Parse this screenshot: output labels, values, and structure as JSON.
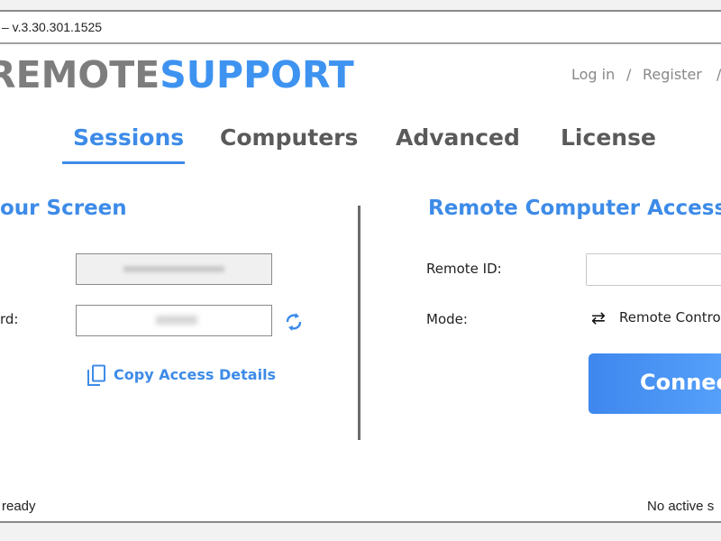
{
  "window": {
    "title": "– v.3.30.301.1525"
  },
  "logo": {
    "part1": "REMOTE",
    "part2": "SUPPORT"
  },
  "nav": {
    "login": "Log in",
    "sep1": "/",
    "register": "Register",
    "sep2": "/"
  },
  "tabs": [
    {
      "label": "Sessions",
      "active": true
    },
    {
      "label": "Computers"
    },
    {
      "label": "Advanced"
    },
    {
      "label": "License"
    }
  ],
  "left": {
    "heading": "our Screen",
    "password_label": "rd:",
    "copy_label": "Copy Access Details"
  },
  "right": {
    "heading": "Remote Computer Access",
    "remote_id_label": "Remote ID:",
    "remote_id_value": "",
    "mode_label": "Mode:",
    "mode_value": "Remote Contro",
    "connect_label": "Connect"
  },
  "status": {
    "left": "ready",
    "right": "No active s"
  },
  "colors": {
    "accent": "#3d8be8",
    "logo_gray": "#7d7d7d"
  }
}
